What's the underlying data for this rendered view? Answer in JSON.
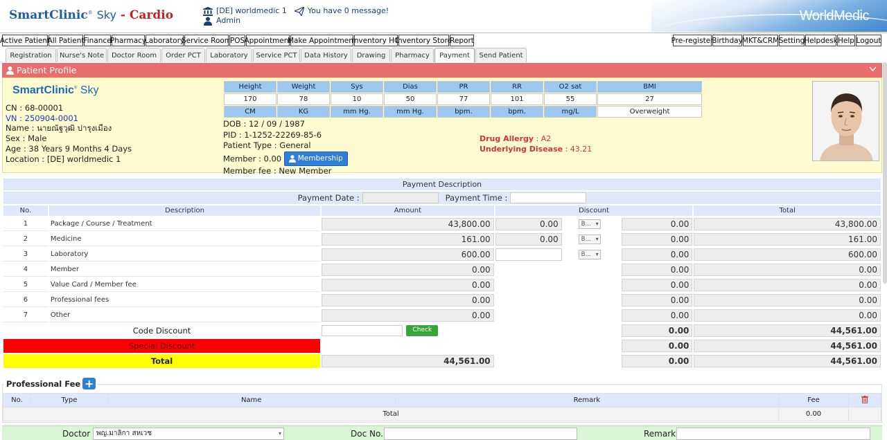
{
  "header": {
    "brand_main": "SmartClinic",
    "brand_sky": "Sky",
    "brand_suffix": "- Cardio",
    "clinic": "[DE] worldmedic 1",
    "message": "You have 0 message!",
    "user": "Admin",
    "partner_logo": "WorldMedic"
  },
  "mainnav": {
    "left": [
      "Active Patient",
      "All Patient",
      "Finance",
      "Pharmacy",
      "Laboratory",
      "Service Room",
      "POS",
      "Appointment",
      "Make Appointment",
      "Inventory HO",
      "Inventory Store",
      "Report"
    ],
    "right": [
      "Pre-register",
      "Birthday",
      "MKT&CRM",
      "Setting",
      "Helpdesk",
      "Help",
      "Logout"
    ]
  },
  "subtabs": [
    "Registration",
    "Nurse's Note",
    "Doctor Room",
    "Order PCT",
    "Laboratory",
    "Service PCT",
    "Data History",
    "Drawing",
    "Pharmacy",
    "Payment",
    "Send Patient"
  ],
  "active_tab": "Payment",
  "profile": {
    "bar_title": "Patient Profile",
    "logo_main": "SmartClinic",
    "logo_sky": "Sky",
    "cn": "CN : 68-00001",
    "vn": "VN : 250904-0001",
    "name": "Name : นายณัฐวุฒิ ปารุงเมือง",
    "sex": "Sex : Male",
    "age": "Age : 38 Years 9 Months 4 Days",
    "location": "Location : [DE] worldmedic 1",
    "dob": "DOB : 12 / 09 / 1987",
    "pid": "PID : 1-1252-22269-85-6",
    "patient_type": "Patient Type : General",
    "member": "Member : 0.00",
    "membership_btn": "Membership",
    "member_fee": "Member fee : New Member",
    "drug_allergy_label": "Drug Allergy",
    "drug_allergy_value": " : A2",
    "underlying_label": "Underlying Disease",
    "underlying_value": " : 43.21"
  },
  "vitals": {
    "headers": [
      "Height",
      "Weight",
      "Sys",
      "Dias",
      "PR",
      "RR",
      "O2 sat",
      "BMI"
    ],
    "values": [
      "170",
      "78",
      "10",
      "50",
      "77",
      "101",
      "55",
      "27"
    ],
    "units": [
      "CM",
      "KG",
      "mm Hg.",
      "mm Hg.",
      "bpm.",
      "bpm.",
      "mg/L",
      "Overweight"
    ]
  },
  "payment": {
    "title": "Payment Description",
    "date_label": "Payment Date :",
    "time_label": "Payment Time :",
    "col_no": "No.",
    "col_desc": "Description",
    "col_amount": "Amount",
    "col_discount": "Discount",
    "col_total": "Total",
    "rows": [
      {
        "no": "1",
        "desc": "Package / Course / Treatment",
        "amount": "43,800.00",
        "disc": "0.00",
        "sel": "B...",
        "disc2": "0.00",
        "total": "43,800.00"
      },
      {
        "no": "2",
        "desc": "Medicine",
        "amount": "161.00",
        "disc": "0.00",
        "sel": "B...",
        "disc2": "0.00",
        "total": "161.00"
      },
      {
        "no": "3",
        "desc": "Laboratory",
        "amount": "600.00",
        "disc": "",
        "sel": "B...",
        "disc2": "0.00",
        "total": "600.00"
      },
      {
        "no": "4",
        "desc": "Member",
        "amount": "0.00",
        "disc2": "0.00",
        "total": "0.00"
      },
      {
        "no": "5",
        "desc": "Value Card / Member fee",
        "amount": "0.00",
        "disc2": "0.00",
        "total": "0.00"
      },
      {
        "no": "6",
        "desc": "Professional fees",
        "amount": "0.00",
        "disc2": "0.00",
        "total": "0.00"
      },
      {
        "no": "7",
        "desc": "Other",
        "amount": "0.00",
        "disc2": "0.00",
        "total": "0.00"
      }
    ],
    "code_discount_label": "Code Discount",
    "check_btn": "Check",
    "code_disc": "0.00",
    "code_total": "44,561.00",
    "special_label": "Special Discount",
    "special_disc": "0.00",
    "special_total": "44,561.00",
    "total_label": "Total",
    "total_amount": "44,561.00",
    "total_disc": "0.00",
    "total_total": "44,561.00"
  },
  "prof_fee": {
    "title": "Professional Fee",
    "col_no": "No.",
    "col_type": "Type",
    "col_name": "Name",
    "col_remark": "Remark",
    "col_fee": "Fee",
    "total_label": "Total",
    "total_value": "0.00"
  },
  "doc_form": {
    "doctor_label": "Doctor :",
    "doctor_value": "พญ.มาลิกา สหเวช",
    "docno_label": "Doc No. :",
    "remark_label": "Remark :"
  },
  "colors": {
    "accent": "#1b5fa8",
    "profile_bar": "#e86e6e",
    "profile_bg": "#fffbd1",
    "vital_header": "#9cc8ef",
    "special_row": "#ff0000",
    "total_row": "#ffff00",
    "check_btn": "#3aa63a",
    "doc_form_bg": "#d9f7d4"
  },
  "icons": [
    "bank-icon",
    "paper-plane-icon",
    "user-icon",
    "chevron-down-icon",
    "plus-icon",
    "trash-icon"
  ]
}
